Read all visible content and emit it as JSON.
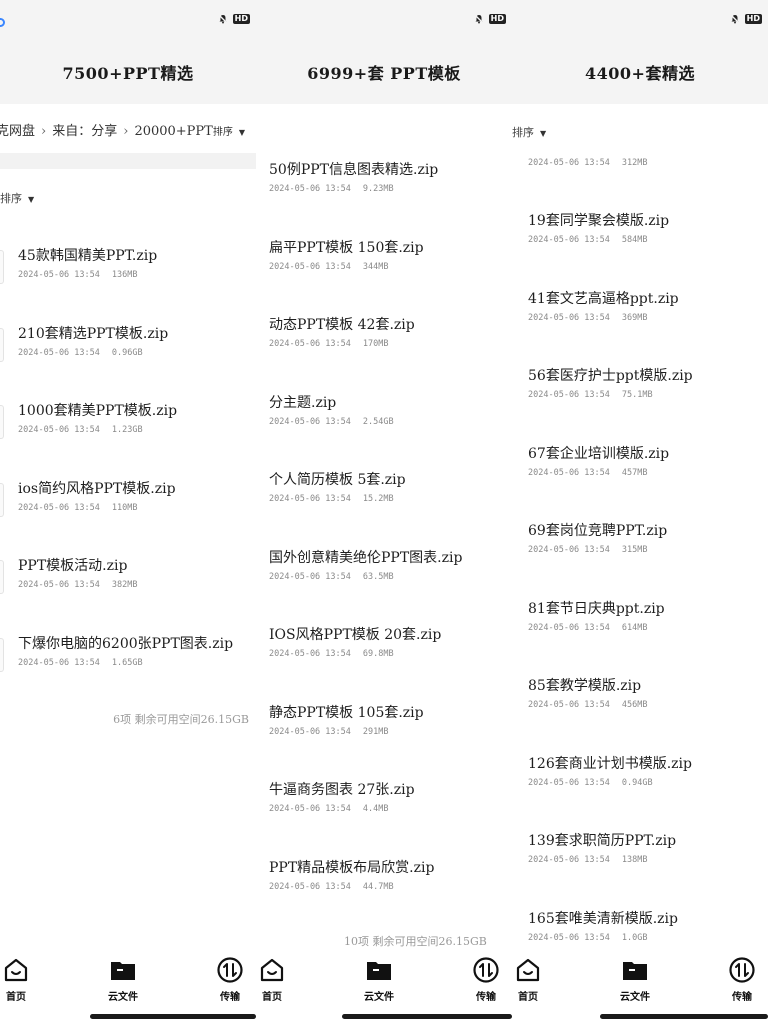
{
  "panel1": {
    "hero": "7500+PPT精选",
    "breadcrumb": {
      "root": "克网盘",
      "from": "来自：分享",
      "folder": "20000+PPT",
      "sort_inline": "排序"
    },
    "sort_label": "排序",
    "files": [
      {
        "name": "45款韩国精美PPT.zip",
        "time": "2024-05-06 13:54",
        "size": "136MB"
      },
      {
        "name": "210套精选PPT模板.zip",
        "time": "2024-05-06 13:54",
        "size": "0.96GB"
      },
      {
        "name": "1000套精美PPT模板.zip",
        "time": "2024-05-06 13:54",
        "size": "1.23GB"
      },
      {
        "name": "ios简约风格PPT模板.zip",
        "time": "2024-05-06 13:54",
        "size": "110MB"
      },
      {
        "name": "PPT模板活动.zip",
        "time": "2024-05-06 13:54",
        "size": "382MB"
      },
      {
        "name": "下爆你电脑的6200张PPT图表.zip",
        "time": "2024-05-06 13:54",
        "size": "1.65GB"
      }
    ],
    "footer": "6项 剩余可用空间26.15GB"
  },
  "panel2": {
    "hero": "6999+套 PPT模板",
    "files": [
      {
        "name": "50例PPT信息图表精选.zip",
        "time": "2024-05-06 13:54",
        "size": "9.23MB"
      },
      {
        "name": "扁平PPT模板 150套.zip",
        "time": "2024-05-06 13:54",
        "size": "344MB"
      },
      {
        "name": "动态PPT模板 42套.zip",
        "time": "2024-05-06 13:54",
        "size": "170MB"
      },
      {
        "name": "分主题.zip",
        "time": "2024-05-06 13:54",
        "size": "2.54GB"
      },
      {
        "name": "个人简历模板 5套.zip",
        "time": "2024-05-06 13:54",
        "size": "15.2MB"
      },
      {
        "name": "国外创意精美绝伦PPT图表.zip",
        "time": "2024-05-06 13:54",
        "size": "63.5MB"
      },
      {
        "name": "IOS风格PPT模板 20套.zip",
        "time": "2024-05-06 13:54",
        "size": "69.8MB"
      },
      {
        "name": "静态PPT模板 105套.zip",
        "time": "2024-05-06 13:54",
        "size": "291MB"
      },
      {
        "name": "牛逼商务图表 27张.zip",
        "time": "2024-05-06 13:54",
        "size": "4.4MB"
      },
      {
        "name": "PPT精品模板布局欣赏.zip",
        "time": "2024-05-06 13:54",
        "size": "44.7MB"
      }
    ],
    "footer": "10项 剩余可用空间26.15GB"
  },
  "panel3": {
    "hero": "4400+套精选",
    "sort_label": "排序",
    "partial": {
      "time": "2024-05-06 13:54",
      "size": "312MB"
    },
    "files": [
      {
        "name": "19套同学聚会模版.zip",
        "time": "2024-05-06 13:54",
        "size": "584MB"
      },
      {
        "name": "41套文艺高逼格ppt.zip",
        "time": "2024-05-06 13:54",
        "size": "369MB"
      },
      {
        "name": "56套医疗护士ppt模版.zip",
        "time": "2024-05-06 13:54",
        "size": "75.1MB"
      },
      {
        "name": "67套企业培训模版.zip",
        "time": "2024-05-06 13:54",
        "size": "457MB"
      },
      {
        "name": "69套岗位竞聘PPT.zip",
        "time": "2024-05-06 13:54",
        "size": "315MB"
      },
      {
        "name": "81套节日庆典ppt.zip",
        "time": "2024-05-06 13:54",
        "size": "614MB"
      },
      {
        "name": "85套教学模版.zip",
        "time": "2024-05-06 13:54",
        "size": "456MB"
      },
      {
        "name": "126套商业计划书模版.zip",
        "time": "2024-05-06 13:54",
        "size": "0.94GB"
      },
      {
        "name": "139套求职简历PPT.zip",
        "time": "2024-05-06 13:54",
        "size": "138MB"
      },
      {
        "name": "165套唯美清新模版.zip",
        "time": "2024-05-06 13:54",
        "size": "1.0GB"
      }
    ]
  },
  "tabs": {
    "home": "首页",
    "cloud": "云文件",
    "transfer": "传输"
  },
  "status": {
    "hd_badge": "HD"
  },
  "icons": {
    "bell_muted": "bell-muted-icon",
    "file": "file-icon",
    "home": "home-icon",
    "cloud": "folder-icon",
    "transfer": "transfer-icon"
  }
}
